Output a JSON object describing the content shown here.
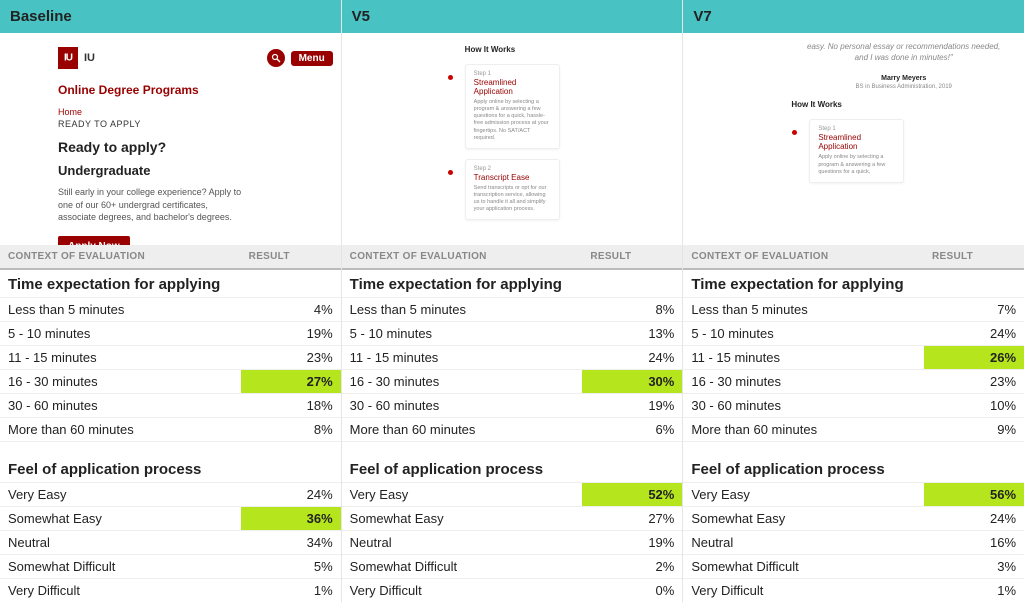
{
  "columns": [
    {
      "title": "Baseline"
    },
    {
      "title": "V5"
    },
    {
      "title": "V7"
    }
  ],
  "tableHeaders": {
    "context": "CONTEXT OF EVALUATION",
    "result": "RESULT"
  },
  "sections": [
    {
      "title": "Time expectation for applying",
      "rows": [
        {
          "label": "Less than 5 minutes",
          "vals": [
            "4%",
            "8%",
            "7%"
          ],
          "hl": [
            false,
            false,
            false
          ]
        },
        {
          "label": "5 - 10 minutes",
          "vals": [
            "19%",
            "13%",
            "24%"
          ],
          "hl": [
            false,
            false,
            false
          ]
        },
        {
          "label": "11 - 15 minutes",
          "vals": [
            "23%",
            "24%",
            "26%"
          ],
          "hl": [
            false,
            false,
            true
          ]
        },
        {
          "label": "16 - 30 minutes",
          "vals": [
            "27%",
            "30%",
            "23%"
          ],
          "hl": [
            true,
            true,
            false
          ]
        },
        {
          "label": "30 - 60 minutes",
          "vals": [
            "18%",
            "19%",
            "10%"
          ],
          "hl": [
            false,
            false,
            false
          ]
        },
        {
          "label": "More than 60 minutes",
          "vals": [
            "8%",
            "6%",
            "9%"
          ],
          "hl": [
            false,
            false,
            false
          ]
        }
      ]
    },
    {
      "title": "Feel of application process",
      "rows": [
        {
          "label": "Very Easy",
          "vals": [
            "24%",
            "52%",
            "56%"
          ],
          "hl": [
            false,
            true,
            true
          ]
        },
        {
          "label": "Somewhat Easy",
          "vals": [
            "36%",
            "27%",
            "24%"
          ],
          "hl": [
            true,
            false,
            false
          ]
        },
        {
          "label": "Neutral",
          "vals": [
            "34%",
            "19%",
            "16%"
          ],
          "hl": [
            false,
            false,
            false
          ]
        },
        {
          "label": "Somewhat Difficult",
          "vals": [
            "5%",
            "2%",
            "3%"
          ],
          "hl": [
            false,
            false,
            false
          ]
        },
        {
          "label": "Very Difficult",
          "vals": [
            "1%",
            "0%",
            "1%"
          ],
          "hl": [
            false,
            false,
            false
          ]
        }
      ]
    }
  ],
  "baseline": {
    "iu": "IU",
    "menu": "Menu",
    "h": "Online Degree Programs",
    "home": "Home",
    "ready": "READY TO APPLY",
    "rta": "Ready to apply?",
    "ug": "Undergraduate",
    "body": "Still early in your college experience? Apply to one of our 60+ undergrad certificates, associate degrees, and bachelor's degrees.",
    "apply": "Apply Now"
  },
  "hiw": {
    "title": "How It Works",
    "step1": "Step 1",
    "card1t": "Streamlined Application",
    "card1b": "Apply online by selecting a program & answering a few questions for a quick, hassle-free admission process at your fingertips. No SAT/ACT required.",
    "step2": "Step 2",
    "card2t": "Transcript Ease",
    "card2b": "Send transcripts or opt for our transcription service, allowing us to handle it all and simplify your application process."
  },
  "v7": {
    "quote": "easy. No personal essay or recommendations needed, and I was done in minutes!\"",
    "name": "Marry Meyers",
    "sub": "BS in Business Administration, 2019",
    "hiw": "How It Works",
    "step1": "Step 1",
    "card1t": "Streamlined Application",
    "card1b": "Apply online by selecting a program & answering a few questions for a quick,"
  }
}
